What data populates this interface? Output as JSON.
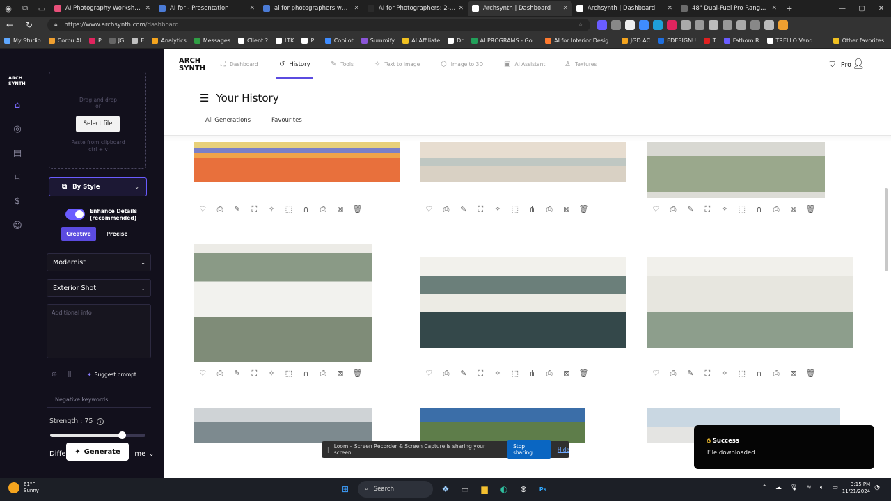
{
  "browser": {
    "tabs": [
      {
        "title": "AI Photography Workshop Da",
        "color": "#e8507a",
        "active": false
      },
      {
        "title": "AI for - Presentation",
        "color": "#4b7bd6",
        "active": false
      },
      {
        "title": "ai for photographers worksho",
        "color": "#4b7bd6",
        "active": false
      },
      {
        "title": "AI for Photographers: 2-Day",
        "color": "#2b2b2b",
        "active": false
      },
      {
        "title": "Archsynth | Dashboard",
        "color": "#ffffff",
        "active": true
      },
      {
        "title": "Archsynth | Dashboard",
        "color": "#ffffff",
        "active": false
      },
      {
        "title": "48\" Dual-Fuel Pro Range with",
        "color": "#6b6b6b",
        "active": false
      }
    ],
    "url_host": "https://www.archsynth.com",
    "url_path": "/dashboard",
    "bookmarks": [
      {
        "label": "My Studio",
        "color": "#5fa8ff"
      },
      {
        "label": "Corbu AI",
        "color": "#f0a030"
      },
      {
        "label": "P",
        "color": "#e0245e"
      },
      {
        "label": "JG",
        "color": "#666666"
      },
      {
        "label": "E",
        "color": "#c0c0c0"
      },
      {
        "label": "Analytics",
        "color": "#f4a41e"
      },
      {
        "label": "Messages",
        "color": "#2f9e44"
      },
      {
        "label": "Client ?",
        "color": "#ffffff"
      },
      {
        "label": "LTK",
        "color": "#ffffff"
      },
      {
        "label": "PL",
        "color": "#ffffff"
      },
      {
        "label": "Copilot",
        "color": "#3f8cff"
      },
      {
        "label": "Summify",
        "color": "#8a55d7"
      },
      {
        "label": "AI Affiliate",
        "color": "#f0c020"
      },
      {
        "label": "Dr",
        "color": "#ffffff"
      },
      {
        "label": "AI PROGRAMS - Go...",
        "color": "#22a05a"
      },
      {
        "label": "AI for Interior Desig...",
        "color": "#ff7a2f"
      },
      {
        "label": "JGD AC",
        "color": "#f4a41e"
      },
      {
        "label": "EDESIGNU",
        "color": "#1f6fe0"
      },
      {
        "label": "T",
        "color": "#e02020"
      },
      {
        "label": "Fathom R",
        "color": "#6a5cff"
      },
      {
        "label": "TRELLO Vend",
        "color": "#ffffff"
      }
    ],
    "other_favorites": "Other favorites"
  },
  "sidebar_rail": {
    "logo_line1": "ARCH",
    "logo_line2": "SYNTH"
  },
  "panel": {
    "drop_line1": "Drag and drop",
    "drop_line2": "or",
    "select_file": "Select file",
    "paste_line1": "Paste from clipboard",
    "paste_line2": "ctrl + v",
    "by_style": "By Style",
    "enhance_line1": "Enhance Details",
    "enhance_line2": "(recommended)",
    "creative": "Creative",
    "precise": "Precise",
    "style_value": "Modernist",
    "shot_value": "Exterior Shot",
    "additional_placeholder": "Additional info",
    "suggest_prompt": "Suggest prompt",
    "negative_keywords": "Negative keywords",
    "strength_label": "Strength : 75",
    "strength_value": 75,
    "diff_left": "Diffe",
    "diff_right": "me",
    "generate": "Generate"
  },
  "topnav": {
    "logo_line1": "ARCH",
    "logo_line2": "SYNTH",
    "items": [
      {
        "label": "Dashboard"
      },
      {
        "label": "History"
      },
      {
        "label": "Tools"
      },
      {
        "label": "Text to image"
      },
      {
        "label": "Image to 3D"
      },
      {
        "label": "AI Assistant"
      },
      {
        "label": "Textures"
      }
    ],
    "pro": "Pro"
  },
  "history": {
    "title": "Your History",
    "filters": [
      {
        "label": "All Generations"
      },
      {
        "label": "Favourites"
      }
    ]
  },
  "cards": [
    {
      "style": "colorful"
    },
    {
      "style": "beige"
    },
    {
      "style": "sage-gold"
    },
    {
      "style": "sage-fridge"
    },
    {
      "style": "dark-hood"
    },
    {
      "style": "sage-white"
    },
    {
      "style": "exterior-gray"
    },
    {
      "style": "exterior-palm"
    },
    {
      "style": "exterior-light"
    }
  ],
  "toast": {
    "title": "Success",
    "message": "File downloaded"
  },
  "loom": {
    "message": "Loom – Screen Recorder & Screen Capture is sharing your screen.",
    "stop": "Stop sharing",
    "hide": "Hide"
  },
  "taskbar": {
    "temp": "61°F",
    "weather": "Sunny",
    "search": "Search",
    "time": "3:15 PM",
    "date": "11/21/2024"
  }
}
